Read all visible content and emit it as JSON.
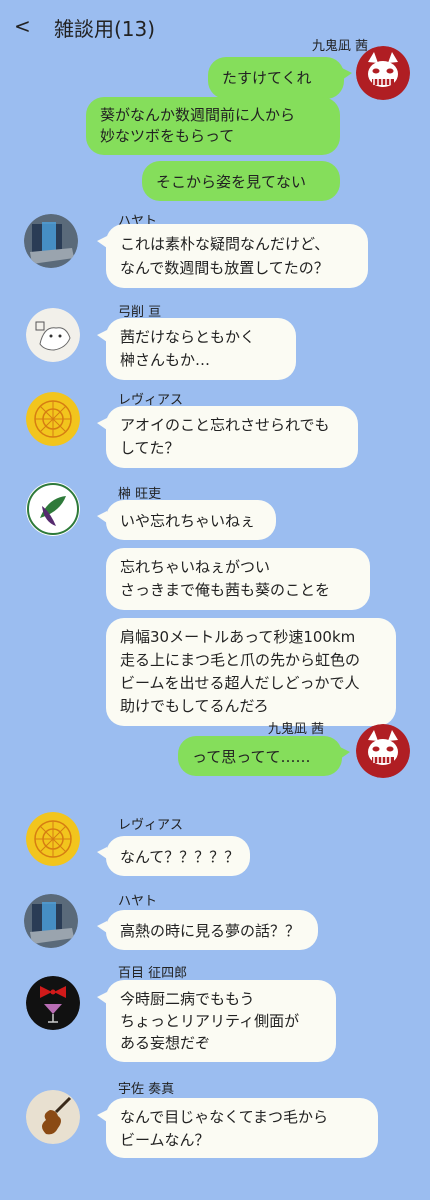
{
  "header": {
    "back_icon": "<",
    "title": "雑談用(13)"
  },
  "colors": {
    "background": "#9bbdf0",
    "my_bubble": "#85de5b",
    "their_bubble": "#fbfbf3"
  },
  "messages": [
    {
      "sender": "九鬼凪 茜",
      "lines": [
        "たすけてくれ"
      ]
    },
    {
      "lines": [
        "葵がなんか数週間前に人から",
        "妙なツボをもらって"
      ]
    },
    {
      "lines": [
        "そこから姿を見てない"
      ]
    },
    {
      "sender": "ハヤト",
      "lines": [
        "これは素朴な疑問なんだけど、",
        "なんで数週間も放置してたの？"
      ]
    },
    {
      "sender": "弓削 亘",
      "lines": [
        "茜だけならともかく",
        "榊さんもか…"
      ]
    },
    {
      "sender": "レヴィアス",
      "lines": [
        "アオイのこと忘れさせられでも",
        "してた？"
      ]
    },
    {
      "sender": "榊 旺吏",
      "lines": [
        "いや忘れちゃいねぇ"
      ]
    },
    {
      "lines": [
        "忘れちゃいねぇがつい",
        "さっきまで俺も茜も葵のことを"
      ]
    },
    {
      "lines": [
        "肩幅30メートルあって秒速100km",
        "走る上にまつ毛と爪の先から虹色の",
        "ビームを出せる超人だしどっかで人",
        "助けでもしてるんだろ"
      ]
    },
    {
      "sender": "九鬼凪 茜",
      "lines": [
        "って思ってて……"
      ]
    },
    {
      "sender": "レヴィアス",
      "lines": [
        "なんて？？？？？"
      ]
    },
    {
      "sender": "ハヤト",
      "lines": [
        "高熱の時に見る夢の話？？"
      ]
    },
    {
      "sender": "百目 征四郎",
      "lines": [
        "今時厨二病でももう",
        "ちょっとリアリティ側面が",
        "ある妄想だぞ"
      ]
    },
    {
      "sender": "宇佐 奏真",
      "lines": [
        "なんで目じゃなくてまつ毛から",
        "ビームなん？"
      ]
    }
  ]
}
